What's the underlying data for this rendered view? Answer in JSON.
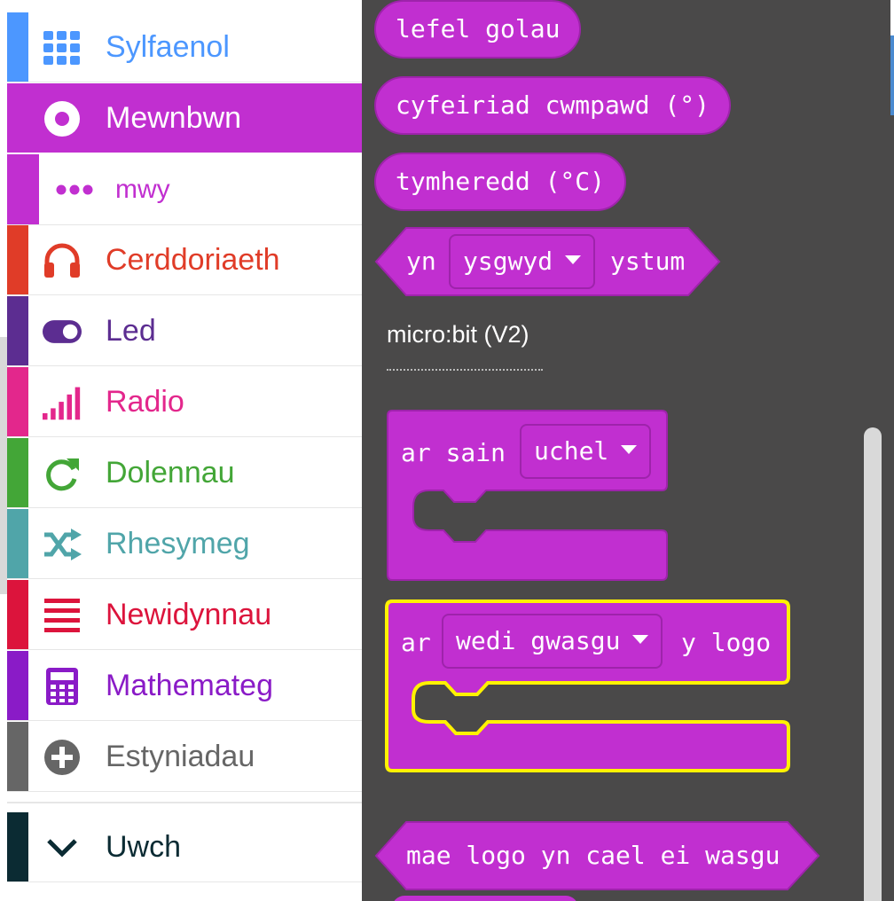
{
  "toolbox": {
    "categories": [
      {
        "label": "Sylfaenol",
        "color": "#4c97ff",
        "icon": "grid-icon"
      },
      {
        "label": "Mewnbwn",
        "color": "#c12fd0",
        "icon": "radio-dot-icon"
      },
      {
        "label": "Cerddoriaeth",
        "color": "#e03c28",
        "icon": "headphones-icon"
      },
      {
        "label": "Led",
        "color": "#5c2d91",
        "icon": "toggle-icon"
      },
      {
        "label": "Radio",
        "color": "#e3278c",
        "icon": "signal-bars-icon"
      },
      {
        "label": "Dolennau",
        "color": "#43a637",
        "icon": "refresh-icon"
      },
      {
        "label": "Rhesymeg",
        "color": "#50a5a9",
        "icon": "shuffle-icon"
      },
      {
        "label": "Newidynnau",
        "color": "#dc143c",
        "icon": "lines-icon"
      },
      {
        "label": "Mathemateg",
        "color": "#8a1bc7",
        "icon": "calculator-icon"
      },
      {
        "label": "Estyniadau",
        "color": "#666666",
        "icon": "plus-circle-icon"
      }
    ],
    "selected": "Mewnbwn",
    "sub_item": {
      "label": "mwy",
      "icon": "ellipsis-icon"
    },
    "advanced": {
      "label": "Uwch",
      "color": "#0b2b33",
      "icon": "chevron-down-icon"
    }
  },
  "flyout": {
    "block_color": "#c12fd0",
    "highlight_color": "#fff200",
    "blocks": {
      "light_level": "lefel golau",
      "compass_heading": "cyfeiriad cwmpawd (°)",
      "temperature": "tymheredd (°C)",
      "gesture_prefix": "yn",
      "gesture_value": "ysgwyd",
      "gesture_suffix": "ystum"
    },
    "section_label": "micro:bit (V2)",
    "on_sound": {
      "prefix": "ar sain",
      "value": "uchel"
    },
    "on_logo": {
      "prefix": "ar",
      "value": "wedi gwasgu",
      "suffix": "y logo"
    },
    "logo_pressed": "mae logo yn cael ei wasgu"
  }
}
